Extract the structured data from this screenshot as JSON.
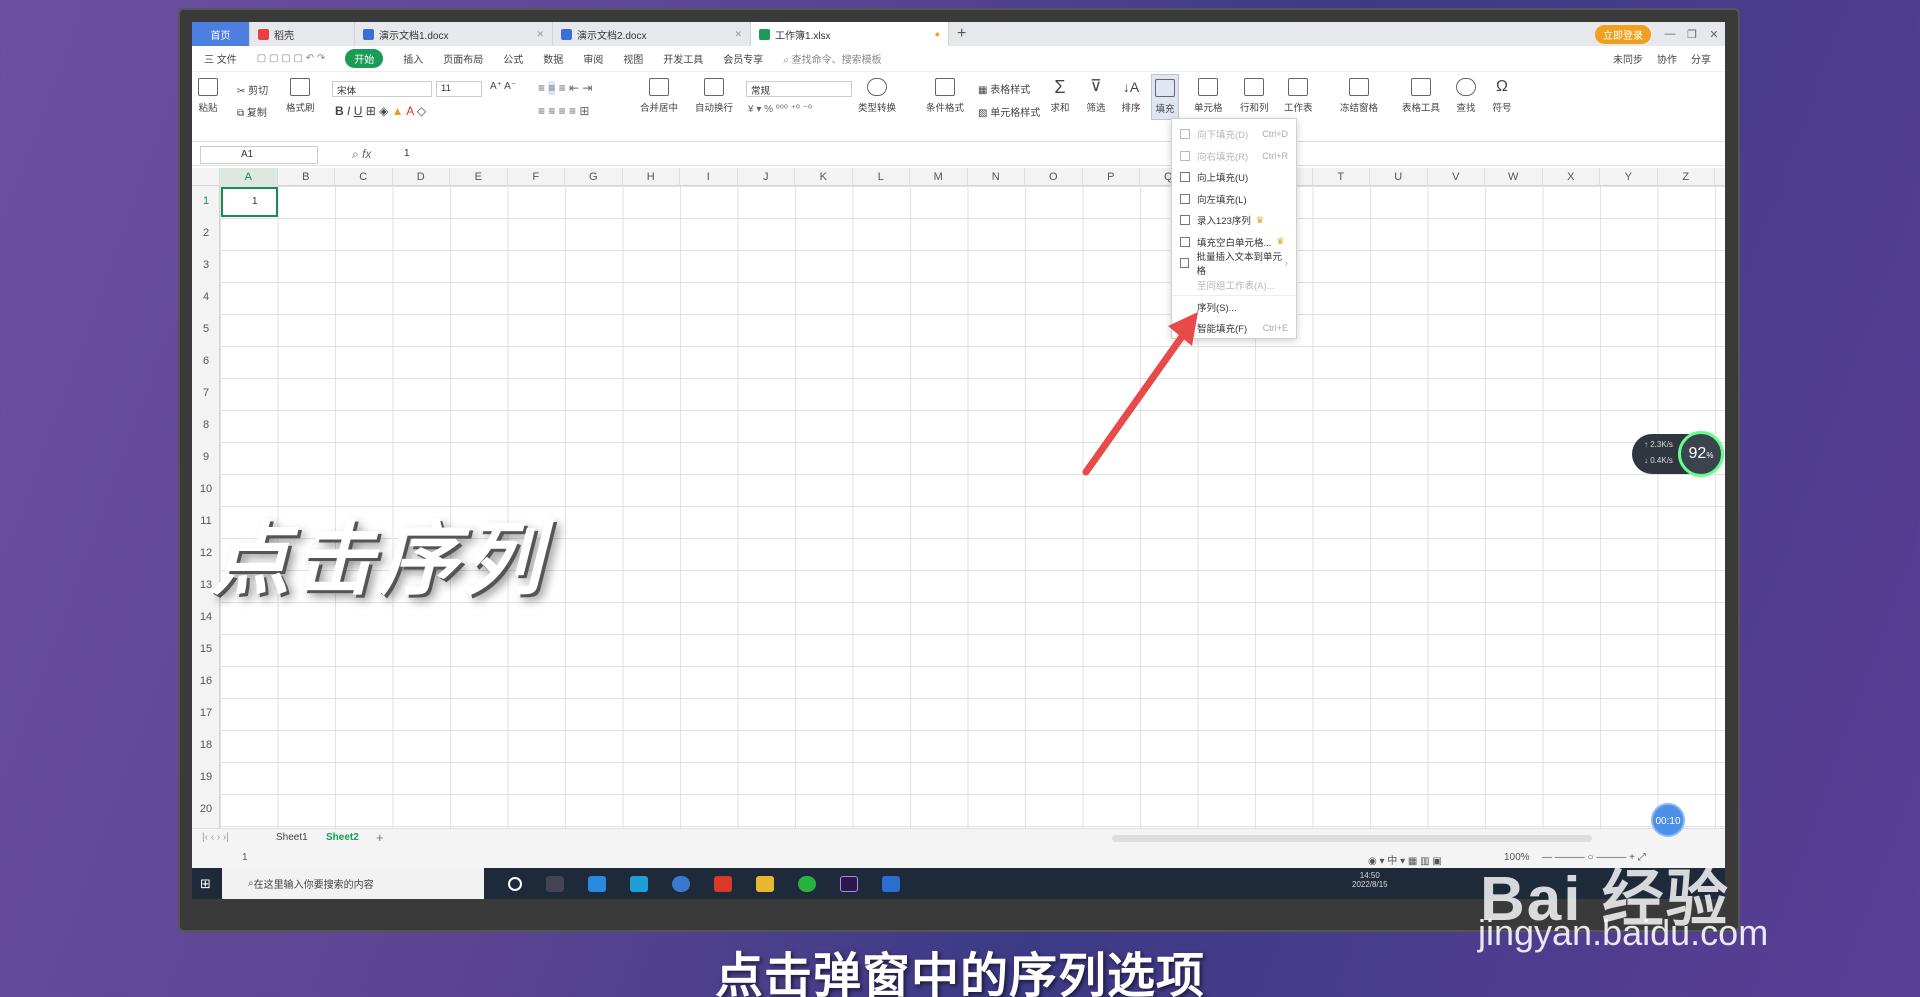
{
  "tabs": [
    {
      "label": "首页"
    },
    {
      "label": "稻壳"
    },
    {
      "label": "演示文档1.docx"
    },
    {
      "label": "演示文档2.docx"
    },
    {
      "label": "工作簿1.xlsx"
    }
  ],
  "login_label": "立即登录",
  "menu": {
    "file": "三 文件",
    "start": "开始",
    "items": [
      "插入",
      "页面布局",
      "公式",
      "数据",
      "审阅",
      "视图",
      "开发工具",
      "会员专享"
    ],
    "search": "查找命令、搜索模板",
    "sync": "未同步",
    "collab": "协作",
    "share": "分享"
  },
  "ribbon": {
    "paste": "粘贴",
    "cut": "剪切",
    "copy": "复制",
    "format_brush": "格式刷",
    "font_name": "宋体",
    "font_size": "11",
    "number_format": "常规",
    "merge": "合并居中",
    "wrap": "自动换行",
    "type_convert": "类型转换",
    "cond_format": "条件格式",
    "table_style": "表格样式",
    "cell_style": "单元格样式",
    "sum": "求和",
    "filter": "筛选",
    "sort": "排序",
    "fill": "填充",
    "cell": "单元格",
    "row_col": "行和列",
    "worksheet": "工作表",
    "freeze": "冻结窗格",
    "table_tools": "表格工具",
    "find": "查找",
    "symbol": "符号"
  },
  "formula": {
    "cell_ref": "A1",
    "fx": "fx",
    "value": "1"
  },
  "columns": [
    "A",
    "B",
    "C",
    "D",
    "E",
    "F",
    "G",
    "H",
    "I",
    "J",
    "K",
    "L",
    "M",
    "N",
    "O",
    "P",
    "Q",
    "R",
    "S",
    "T",
    "U",
    "V",
    "W",
    "X",
    "Y",
    "Z"
  ],
  "rows": [
    "1",
    "2",
    "3",
    "4",
    "5",
    "6",
    "7",
    "8",
    "9",
    "10",
    "11",
    "12",
    "13",
    "14",
    "15",
    "16",
    "17",
    "18",
    "19",
    "20"
  ],
  "cell_a1": "1",
  "fill_menu": [
    {
      "label": "向下填充(D)",
      "shortcut": "Ctrl+D",
      "disabled": true
    },
    {
      "label": "向右填充(R)",
      "shortcut": "Ctrl+R",
      "disabled": true
    },
    {
      "label": "向上填充(U)",
      "shortcut": "",
      "disabled": false
    },
    {
      "label": "向左填充(L)",
      "shortcut": "",
      "disabled": false
    },
    {
      "label": "录入123序列",
      "shortcut": "",
      "disabled": false
    },
    {
      "label": "填充空白单元格...",
      "shortcut": "",
      "disabled": false
    },
    {
      "label": "批量插入文本到单元格",
      "shortcut": "›",
      "disabled": false
    },
    {
      "label": "至同组工作表(A)...",
      "shortcut": "",
      "disabled": true
    },
    {
      "label": "序列(S)...",
      "shortcut": "",
      "disabled": false
    },
    {
      "label": "智能填充(F)",
      "shortcut": "Ctrl+E",
      "disabled": false
    }
  ],
  "sheets": [
    "Sheet1",
    "Sheet2"
  ],
  "active_sheet": "Sheet2",
  "status": {
    "value": "1",
    "zoom": "100%"
  },
  "taskbar": {
    "search_placeholder": "在这里输入你要搜索的内容",
    "time": "14:50",
    "date": "2022/8/15"
  },
  "overlay": {
    "big_text": "点击序列",
    "subtitle": "点击弹窗中的序列选项",
    "timer": "00:10",
    "speed_up": "2.3K/s",
    "speed_down": "0.4K/s",
    "speed_pct": "92",
    "watermark1": "Bai 经验",
    "watermark2": "jingyan.baidu.com"
  },
  "colors": {
    "accent": "#1a9b56",
    "home_tab": "#4c7fe0",
    "selection": "#1a8a5a",
    "arrow": "#e84a4a"
  }
}
